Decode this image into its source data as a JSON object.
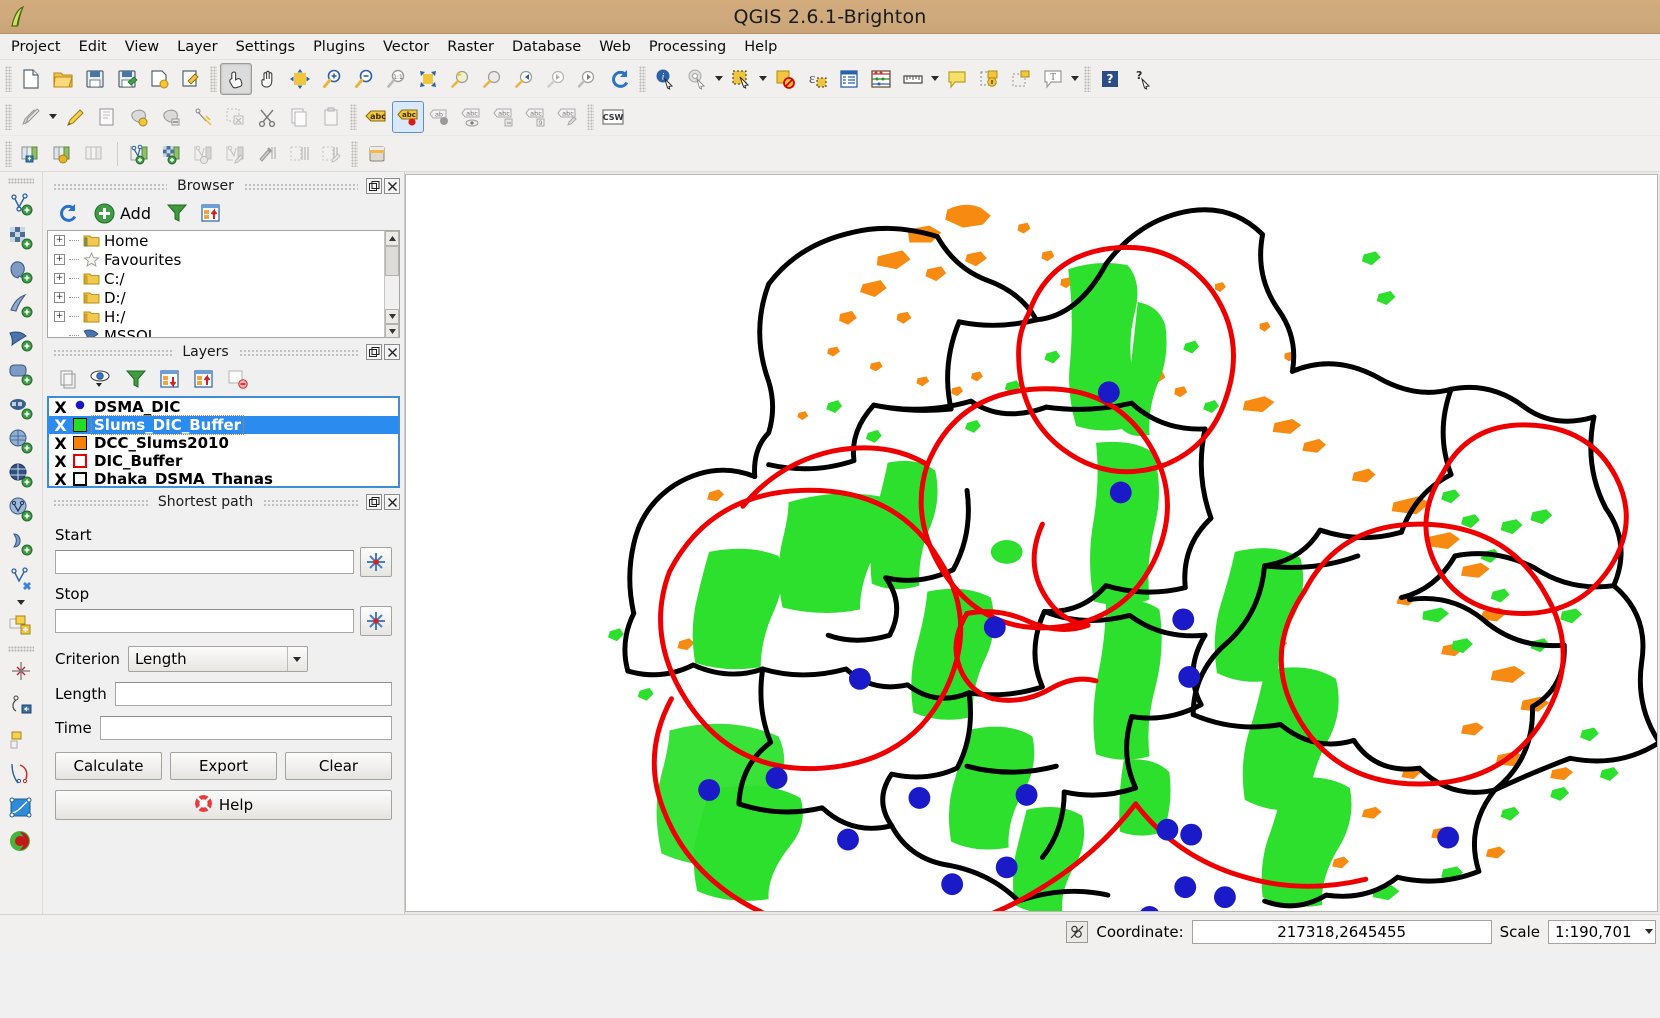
{
  "window": {
    "title": "QGIS 2.6.1-Brighton",
    "app_icon": "qgis-logo-icon"
  },
  "menubar": {
    "items": [
      {
        "label": "Project"
      },
      {
        "label": "Edit"
      },
      {
        "label": "View"
      },
      {
        "label": "Layer"
      },
      {
        "label": "Settings"
      },
      {
        "label": "Plugins"
      },
      {
        "label": "Vector"
      },
      {
        "label": "Raster"
      },
      {
        "label": "Database"
      },
      {
        "label": "Web"
      },
      {
        "label": "Processing"
      },
      {
        "label": "Help"
      }
    ]
  },
  "toolbars": {
    "file_map": [
      {
        "name": "new-project-icon"
      },
      {
        "name": "open-project-icon"
      },
      {
        "name": "save-project-icon"
      },
      {
        "name": "save-project-as-icon"
      },
      {
        "name": "new-print-composer-icon"
      },
      {
        "name": "composer-manager-icon"
      },
      {
        "name": "identify-touch-icon",
        "state": "active"
      },
      {
        "name": "pan-map-icon"
      },
      {
        "name": "pan-to-selection-icon"
      },
      {
        "name": "zoom-in-icon"
      },
      {
        "name": "zoom-out-icon"
      },
      {
        "name": "zoom-native-resolution-icon"
      },
      {
        "name": "zoom-full-icon"
      },
      {
        "name": "zoom-to-selection-icon"
      },
      {
        "name": "zoom-to-layer-icon"
      },
      {
        "name": "zoom-last-icon"
      },
      {
        "name": "zoom-next-icon"
      },
      {
        "name": "zoom-actual-icon"
      },
      {
        "name": "refresh-icon"
      },
      {
        "name": "identify-features-icon"
      },
      {
        "name": "run-feature-action-icon"
      },
      {
        "name": "select-features-icon"
      },
      {
        "name": "deselect-features-icon"
      },
      {
        "name": "select-by-expression-icon"
      },
      {
        "name": "open-attribute-table-icon"
      },
      {
        "name": "statistical-summary-icon"
      },
      {
        "name": "measure-line-icon"
      },
      {
        "name": "map-tips-icon"
      },
      {
        "name": "new-bookmark-icon"
      },
      {
        "name": "show-bookmarks-icon"
      },
      {
        "name": "text-annotation-icon"
      },
      {
        "name": "help-contents-icon"
      },
      {
        "name": "whats-this-icon"
      }
    ],
    "digitizing": [
      {
        "name": "current-edits-icon"
      },
      {
        "name": "toggle-editing-icon"
      },
      {
        "name": "save-layer-edits-icon"
      },
      {
        "name": "add-feature-icon"
      },
      {
        "name": "move-feature-icon"
      },
      {
        "name": "node-tool-icon"
      },
      {
        "name": "delete-selected-icon"
      },
      {
        "name": "cut-features-icon"
      },
      {
        "name": "copy-features-icon"
      },
      {
        "name": "paste-features-icon"
      },
      {
        "name": "label-layer-icon"
      },
      {
        "name": "pin-labels-icon",
        "state": "selected"
      },
      {
        "name": "show-hide-labels-icon"
      },
      {
        "name": "move-label-icon"
      },
      {
        "name": "rotate-label-icon"
      },
      {
        "name": "change-label-icon"
      },
      {
        "name": "style-label-icon"
      },
      {
        "name": "csw-catalog-icon"
      }
    ],
    "database": [
      {
        "name": "db-manager-import-icon"
      },
      {
        "name": "db-manager-export-icon"
      },
      {
        "name": "db-manager-icon"
      },
      {
        "name": "new-network-layer-icon"
      },
      {
        "name": "add-raster-network-icon"
      },
      {
        "name": "network-settings-icon"
      },
      {
        "name": "network-edit-icon"
      },
      {
        "name": "geoprocessing-icon"
      },
      {
        "name": "road-graph-icon"
      },
      {
        "name": "road-graph-edit-icon"
      },
      {
        "name": "processing-toolbox-icon"
      }
    ],
    "left_dock": [
      {
        "name": "add-vector-layer-icon"
      },
      {
        "name": "add-raster-layer-icon"
      },
      {
        "name": "add-postgis-layer-icon"
      },
      {
        "name": "add-spatialite-layer-icon"
      },
      {
        "name": "add-mssql-layer-icon"
      },
      {
        "name": "add-oracle-layer-icon"
      },
      {
        "name": "add-db2-layer-icon"
      },
      {
        "name": "add-wms-layer-icon"
      },
      {
        "name": "add-wcs-layer-icon"
      },
      {
        "name": "add-wfs-layer-icon"
      },
      {
        "name": "add-delimited-text-layer-icon"
      },
      {
        "name": "new-vector-layer-icon"
      },
      {
        "name": "new-memory-layer-icon"
      },
      {
        "name": "layer-properties-icon"
      },
      {
        "name": "snapping-options-icon"
      },
      {
        "name": "offset-curve-icon"
      },
      {
        "name": "simplify-feature-icon"
      },
      {
        "name": "reshape-features-icon"
      },
      {
        "name": "split-features-icon"
      },
      {
        "name": "merge-features-icon"
      }
    ]
  },
  "browser_panel": {
    "title": "Browser",
    "toolbar": {
      "refresh_label": "refresh-icon",
      "add_label": "Add",
      "filter_label": "filter-icon",
      "collapse_label": "collapse-all-icon"
    },
    "tree": [
      {
        "label": "Home",
        "icon": "home-folder-icon",
        "expandable": true
      },
      {
        "label": "Favourites",
        "icon": "star-icon",
        "expandable": true
      },
      {
        "label": "C:/",
        "icon": "folder-icon",
        "expandable": true
      },
      {
        "label": "D:/",
        "icon": "folder-icon",
        "expandable": true
      },
      {
        "label": "H:/",
        "icon": "folder-icon",
        "expandable": true
      },
      {
        "label": "MSSQL",
        "icon": "mssql-icon",
        "expandable": false
      }
    ]
  },
  "layers_panel": {
    "title": "Layers",
    "toolbar": [
      {
        "name": "layer-styling-icon"
      },
      {
        "name": "manage-visibility-icon"
      },
      {
        "name": "filter-legend-icon"
      },
      {
        "name": "expand-all-icon"
      },
      {
        "name": "collapse-all-icon"
      },
      {
        "name": "remove-layer-icon"
      }
    ],
    "layers": [
      {
        "label": "DSMA_DIC",
        "checked": "X",
        "symbol": "point",
        "color": "#1818c8",
        "selected": false
      },
      {
        "label": "Slums_DIC_Buffer",
        "checked": "X",
        "symbol": "fill",
        "color": "#22dd22",
        "selected": true
      },
      {
        "label": "DCC_Slums2010",
        "checked": "X",
        "symbol": "fill",
        "color": "#f88206",
        "selected": false
      },
      {
        "label": "DIC_Buffer",
        "checked": "X",
        "symbol": "outline",
        "color": "#e80000",
        "selected": false
      },
      {
        "label": "Dhaka_DSMA_Thanas",
        "checked": "X",
        "symbol": "outline",
        "color": "#000000",
        "selected": false
      }
    ]
  },
  "shortest_path_panel": {
    "title": "Shortest path",
    "start_label": "Start",
    "start_value": "",
    "stop_label": "Stop",
    "stop_value": "",
    "criterion_label": "Criterion",
    "criterion_value": "Length",
    "length_label": "Length",
    "length_value": "",
    "time_label": "Time",
    "time_value": "",
    "calculate_label": "Calculate",
    "export_label": "Export",
    "clear_label": "Clear",
    "help_label": "Help"
  },
  "statusbar": {
    "render_icon": "render-toggle-icon",
    "coordinate_label": "Coordinate:",
    "coordinate_value": "217318,2645455",
    "scale_label": "Scale",
    "scale_value": "1:190,701"
  },
  "map": {
    "layers_rendered": [
      "Dhaka_DSMA_Thanas",
      "DIC_Buffer",
      "DCC_Slums2010",
      "Slums_DIC_Buffer",
      "DSMA_DIC"
    ],
    "colors": {
      "thana_outline": "#000000",
      "dic_buffer": "#ee0000",
      "slums2010": "#f78b12",
      "slums_dic_buffer": "#2ee02e",
      "dsma_dic_point": "#1a1ac8",
      "background": "#ffffff"
    }
  }
}
